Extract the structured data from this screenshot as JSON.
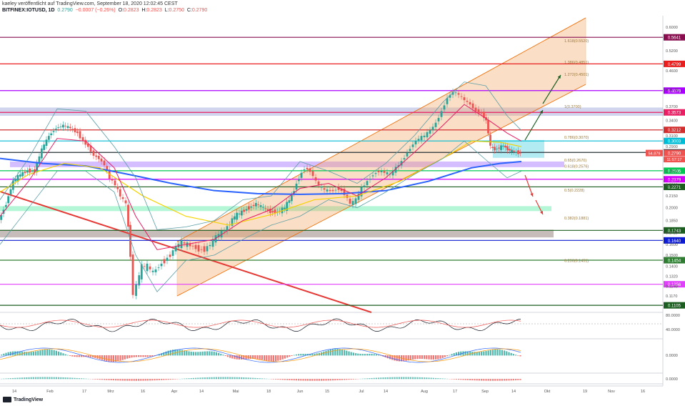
{
  "header": {
    "publisher_line": "kaeley veröffentlicht auf TradingView.com, September 18, 2020 12:02:45 CEST",
    "symbol": "BITFINEX:IOTUSD, 1D",
    "last": "0.2790",
    "change": "−0.0007 (−0.26%)",
    "o_label": "O:",
    "o_value": "0.2823",
    "h_label": "H:",
    "h_value": "0.2823",
    "l_label": "L:",
    "l_value": "0.2750",
    "c_label": "C:",
    "c_value": "0.2790"
  },
  "footer": {
    "brand": "TradingView"
  },
  "colors": {
    "up": "#26a69a",
    "down": "#ef5350",
    "channel": "#f5a25d",
    "ema50": "#f5d300",
    "ema200": "#2962ff",
    "ema20": "#e91e63",
    "bollinger": "#5b9ea6",
    "trendline": "#e53935"
  },
  "chart_data": {
    "type": "candlestick",
    "x_tick_labels": [
      "14",
      "Feb",
      "17",
      "Mrz",
      "16",
      "Apr",
      "14",
      "Mai",
      "18",
      "Jun",
      "15",
      "Jul",
      "14",
      "Aug",
      "17",
      "Sep",
      "14",
      "Okt",
      "19",
      "Nov",
      "16"
    ],
    "y_tick_labels": [
      "0.6000",
      "0.5200",
      "0.4600",
      "0.4100",
      "0.3700",
      "0.3400",
      "0.3100",
      "0.2900",
      "0.2700",
      "0.2500",
      "0.2300",
      "0.2150",
      "0.2000",
      "0.1850",
      "0.1720",
      "0.1600",
      "0.1500",
      "0.1400",
      "0.1320",
      "0.1240",
      "0.1170"
    ],
    "horizontal_levels": [
      {
        "value": 0.5641,
        "label": "0.5641",
        "color": "#880e4f"
      },
      {
        "value": 0.4799,
        "label": "0.4799",
        "color": "#e91e1e"
      },
      {
        "value": 0.4079,
        "label": "0.4079",
        "color": "#aa00ff"
      },
      {
        "value": 0.3573,
        "label": "0.3573",
        "color": "#e91e63"
      },
      {
        "value": 0.3212,
        "label": "0.3212",
        "color": "#d32f2f"
      },
      {
        "value": 0.3003,
        "label": "0.3003",
        "color": "#00bcd4"
      },
      {
        "value": 0.2801,
        "label": "0.2801",
        "color": "#263238"
      },
      {
        "value": 0.2505,
        "label": "0.2505",
        "color": "#00c853"
      },
      {
        "value": 0.2379,
        "label": "0.2379",
        "color": "#d500f9"
      },
      {
        "value": 0.2271,
        "label": "0.2271",
        "color": "#1b5e20"
      },
      {
        "value": 0.1743,
        "label": "0.1743",
        "color": "#1b5e20"
      },
      {
        "value": 0.164,
        "label": "0.1640",
        "color": "#0d1bd3"
      },
      {
        "value": 0.1454,
        "label": "0.1454",
        "color": "#2e7d32"
      },
      {
        "value": 0.1256,
        "label": "0.1256",
        "color": "#e040fb"
      },
      {
        "value": 0.1105,
        "label": "0.1105",
        "color": "#1b5e20"
      }
    ],
    "fib_levels": [
      {
        "label": "1.618(0.5520)",
        "value": 0.552
      },
      {
        "label": "1.386(0.4851)",
        "value": 0.4851
      },
      {
        "label": "1.272(0.4501)",
        "value": 0.4501
      },
      {
        "label": "1(0.3700)",
        "value": 0.37
      },
      {
        "label": "0.786(0.3070)",
        "value": 0.307
      },
      {
        "label": "0.65(0.2670)",
        "value": 0.267
      },
      {
        "label": "0.618(0.2576)",
        "value": 0.2576
      },
      {
        "label": "0.5(0.2228)",
        "value": 0.2228
      },
      {
        "label": "0.382(0.1881)",
        "value": 0.1881
      },
      {
        "label": "0.236(0.1451)",
        "value": 0.1451
      }
    ],
    "price_labels": {
      "last_price": "0.2790",
      "countdown": "11:57:17",
      "prev_value": "54.879"
    },
    "rsi_axis_labels": [
      "80.0000",
      "40.0000"
    ],
    "macd_axis_label": "0.0000",
    "osc_axis_label": "0.0000"
  }
}
